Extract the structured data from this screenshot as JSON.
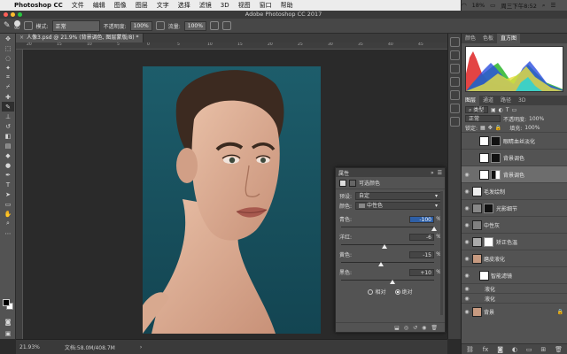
{
  "menubar": {
    "app_name": "Photoshop CC",
    "items": [
      "文件",
      "编辑",
      "图像",
      "图层",
      "文字",
      "选择",
      "滤镜",
      "3D",
      "视图",
      "窗口",
      "帮助"
    ],
    "battery": "18%",
    "clock": "周三下午8:52"
  },
  "window_title": "Adobe Photoshop CC 2017",
  "options": {
    "brush_size": "90",
    "mode_label": "模式:",
    "mode_value": "正常",
    "opacity_label": "不透明度:",
    "opacity_value": "100%",
    "flow_label": "流量:",
    "flow_value": "100%"
  },
  "document_tab": "人像3.psd @ 21.9% (背景调色, 图层蒙版/8) *",
  "ruler_ticks": [
    "20",
    "15",
    "10",
    "5",
    "0",
    "5",
    "10",
    "15",
    "20",
    "25",
    "30",
    "35",
    "40",
    "45"
  ],
  "status": {
    "zoom": "21.93%",
    "doc": "文档:58.0M/408.7M"
  },
  "properties": {
    "title": "属性",
    "subtitle": "可选颜色",
    "preset_label": "预设:",
    "preset_value": "自定",
    "color_label": "颜色:",
    "color_value": "中性色",
    "sliders": [
      {
        "label": "青色:",
        "value": "-100",
        "fraction": 1.0
      },
      {
        "label": "洋红:",
        "value": "-6",
        "fraction": 0.47
      },
      {
        "label": "黄色:",
        "value": "-15",
        "fraction": 0.43
      },
      {
        "label": "黑色:",
        "value": "+10",
        "fraction": 0.55
      }
    ],
    "pct": "%",
    "radio_relative": "相对",
    "radio_absolute": "绝对"
  },
  "right_tabs": [
    "颜色",
    "色板",
    "直方图"
  ],
  "layers_tabs": [
    "图层",
    "通道",
    "路径",
    "3D"
  ],
  "layers_ctl": {
    "kind": "类型",
    "blend": "正常",
    "opacity_label": "不透明度:",
    "opacity_value": "100%",
    "lock_label": "锁定:",
    "fill_label": "填充:",
    "fill_value": "100%"
  },
  "layers": [
    {
      "name": "眼睛血丝淡化",
      "selected": false,
      "small": false
    },
    {
      "name": "背景调色",
      "selected": false,
      "small": false
    },
    {
      "name": "背景调色",
      "selected": true,
      "small": false
    },
    {
      "name": "毛发绘制",
      "selected": false,
      "small": false
    },
    {
      "name": "光影细节",
      "selected": false,
      "small": false
    },
    {
      "name": "中性灰",
      "selected": false,
      "small": false
    },
    {
      "name": "矫正色温",
      "selected": false,
      "small": false
    },
    {
      "name": "磨皮液化",
      "selected": false,
      "small": false
    },
    {
      "name": "智能滤镜",
      "selected": false,
      "small": false
    },
    {
      "name": "液化",
      "selected": false,
      "small": true
    },
    {
      "name": "液化",
      "selected": false,
      "small": true
    },
    {
      "name": "背景",
      "selected": false,
      "small": false
    }
  ],
  "colors": {
    "panel": "#535353",
    "photo_bg": "#1d5d6b",
    "skin": "#d6a98e"
  }
}
